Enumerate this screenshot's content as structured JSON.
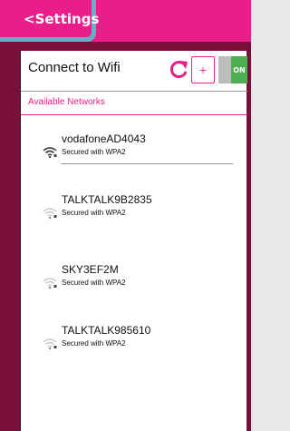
{
  "topbar": {
    "back_label": "<Settings"
  },
  "wifi": {
    "title": "Connect to Wifi",
    "add_label": "+",
    "toggle_label": "ON",
    "toggle_on": true,
    "section_label": "Available Networks",
    "networks": [
      {
        "ssid": "vodafoneAD4043",
        "security": "Secured with WPA2",
        "icon": "wifi-strong-icon"
      },
      {
        "ssid": "TALKTALK9B2835",
        "security": "Secured with WPA2",
        "icon": "wifi-weak-icon"
      },
      {
        "ssid": "SKY3EF2M",
        "security": "Secured with WPA2",
        "icon": "wifi-weak-icon"
      },
      {
        "ssid": "TALKTALK985610",
        "security": "Secured with WPA2",
        "icon": "wifi-weak-icon"
      }
    ]
  },
  "colors": {
    "accent": "#e91e8a",
    "maroon": "#7a1037",
    "highlight": "#5eb3c6",
    "toggle_on": "#4caf50"
  }
}
